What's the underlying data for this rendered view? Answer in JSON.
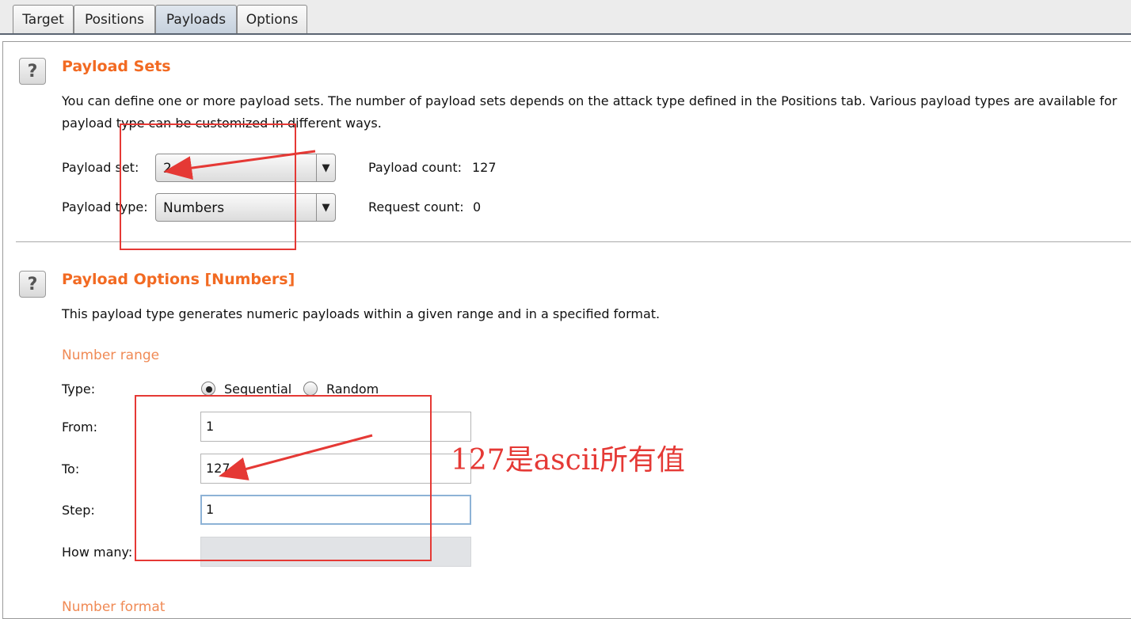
{
  "tabs": [
    {
      "label": "Target"
    },
    {
      "label": "Positions"
    },
    {
      "label": "Payloads",
      "active": true
    },
    {
      "label": "Options"
    }
  ],
  "payload_sets": {
    "title": "Payload Sets",
    "description_line1": "You can define one or more payload sets. The number of payload sets depends on the attack type defined in the Positions tab. Various payload types are available for",
    "description_line2": "payload type can be customized in different ways.",
    "set_label": "Payload set:",
    "set_value": "2",
    "type_label": "Payload type:",
    "type_value": "Numbers",
    "payload_count_label": "Payload count:",
    "payload_count_value": "127",
    "request_count_label": "Request count:",
    "request_count_value": "0"
  },
  "payload_options": {
    "title": "Payload Options [Numbers]",
    "description": "This payload type generates numeric payloads within a given range and in a specified format.",
    "number_range_heading": "Number range",
    "type_label": "Type:",
    "type_options": [
      "Sequential",
      "Random"
    ],
    "type_selected": "Sequential",
    "from_label": "From:",
    "from_value": "1",
    "to_label": "To:",
    "to_value": "127",
    "step_label": "Step:",
    "step_value": "1",
    "how_many_label": "How many:",
    "how_many_value": "",
    "number_format_heading": "Number format"
  },
  "annotation": {
    "text": "127是ascii所有值",
    "color": "#e53935"
  },
  "colors": {
    "section_title": "#f26a22",
    "subheading": "#f08a55",
    "focus_border": "#8db2d6"
  },
  "icons": [
    "help-icon",
    "dropdown-arrow-icon"
  ]
}
